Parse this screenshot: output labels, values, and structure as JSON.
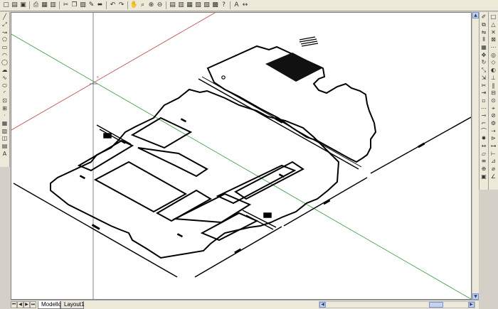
{
  "toolbar_top": {
    "icons": [
      "new-icon",
      "open-icon",
      "save-icon",
      "print-icon",
      "preview-icon",
      "publish-icon",
      "cut-icon",
      "copy-icon",
      "paste-icon",
      "match-properties-icon",
      "brush-icon",
      "undo-icon",
      "redo-icon",
      "pan-icon",
      "zoom-realtime-icon",
      "zoom-window-icon",
      "zoom-previous-icon",
      "properties-icon",
      "design-center-icon",
      "tool-palette-icon",
      "sheet-set-icon",
      "markup-icon",
      "calculator-icon",
      "help-icon",
      "text-style-icon",
      "dimension-icon"
    ],
    "glyphs": [
      "▢",
      "▤",
      "▣",
      "⎙",
      "▦",
      "▥",
      "✂",
      "❐",
      "▧",
      "✎",
      "⬌",
      "↶",
      "↷",
      "✋",
      "⌕",
      "⊕",
      "⊖",
      "▤",
      "▥",
      "▦",
      "▧",
      "▨",
      "▩",
      "?",
      "A",
      "↔"
    ]
  },
  "toolbar_left": {
    "icons": [
      "line-icon",
      "construction-line-icon",
      "polyline-icon",
      "polygon-icon",
      "rectangle-icon",
      "arc-icon",
      "circle-icon",
      "revision-cloud-icon",
      "spline-icon",
      "ellipse-icon",
      "ellipse-arc-icon",
      "insert-block-icon",
      "make-block-icon",
      "point-icon",
      "hatch-icon",
      "gradient-icon",
      "region-icon",
      "table-icon",
      "multiline-text-icon"
    ],
    "glyphs": [
      "╱",
      "⤢",
      "↝",
      "⬠",
      "▭",
      "◠",
      "◯",
      "☁",
      "∿",
      "⬭",
      "◜",
      "⊡",
      "⊞",
      "·",
      "▦",
      "▥",
      "◫",
      "▤",
      "A"
    ]
  },
  "toolbar_right_1": {
    "icons": [
      "erase-icon",
      "copy-object-icon",
      "mirror-icon",
      "offset-icon",
      "array-icon",
      "move-icon",
      "rotate-icon",
      "scale-icon",
      "stretch-icon",
      "trim-icon",
      "extend-icon",
      "break-at-point-icon",
      "break-icon",
      "join-icon",
      "chamfer-icon",
      "fillet-icon",
      "explode-icon",
      "distance-icon",
      "area-icon",
      "list-icon",
      "locate-point-icon",
      "region-mass-icon"
    ],
    "glyphs": [
      "✐",
      "⧉",
      "⇋",
      "⫴",
      "▦",
      "✥",
      "↻",
      "⤡",
      "⇲",
      "✂",
      "⇥",
      "▫",
      "⋯",
      "⊸",
      "⌐",
      "⌒",
      "✸",
      "↔",
      "▱",
      "≡",
      "⊕",
      "▣"
    ]
  },
  "toolbar_right_2": {
    "icons": [
      "endpoint-snap-icon",
      "midpoint-snap-icon",
      "intersection-snap-icon",
      "apparent-intersection-icon",
      "extension-snap-icon",
      "center-snap-icon",
      "quadrant-snap-icon",
      "tangent-snap-icon",
      "perpendicular-snap-icon",
      "parallel-snap-icon",
      "insert-snap-icon",
      "node-snap-icon",
      "nearest-snap-icon",
      "none-snap-icon",
      "osnap-settings-icon",
      "temp-track-icon",
      "from-icon",
      "mid-between-icon",
      "linear-dim-icon",
      "aligned-dim-icon",
      "radius-dim-icon",
      "angular-dim-icon"
    ],
    "glyphs": [
      "□",
      "△",
      "✕",
      "⊠",
      "⋯",
      "◎",
      "◇",
      "◐",
      "⊥",
      "∥",
      "⊟",
      "⊙",
      "⌖",
      "⊘",
      "⚙",
      "⇢",
      "⊳",
      "⊶",
      "⊢",
      "⊿",
      "⌀",
      "∠"
    ]
  },
  "layout_tabs": {
    "model_label": "Modello",
    "layout1_label": "Layout1"
  },
  "nav_buttons": [
    "⏮",
    "◀",
    "▶",
    "⏭"
  ],
  "scroll_arrows": {
    "up": "▲",
    "down": "▼",
    "left": "◀",
    "right": "▶"
  },
  "colors": {
    "drawing_lines": "#000000",
    "ucs_red_axis": "#c84040",
    "ucs_green_axis": "#2e9c3a",
    "crosshair": "#556677",
    "canvas_background": "#ffffff"
  },
  "drawing": {
    "description_visible": "isometric car floor mat outlines with dimension lines"
  }
}
